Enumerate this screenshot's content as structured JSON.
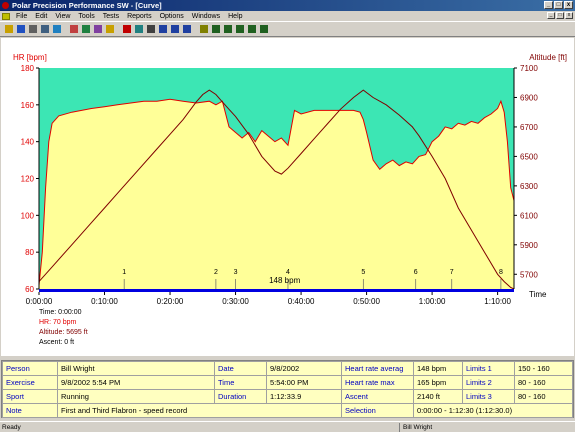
{
  "window": {
    "title": "Polar Precision Performance SW - [Curve]"
  },
  "menu": [
    "File",
    "Edit",
    "View",
    "Tools",
    "Tests",
    "Reports",
    "Options",
    "Windows",
    "Help"
  ],
  "toolbar": [
    "open-icon",
    "save-icon",
    "print-icon",
    "preview-icon",
    "globe-icon",
    "calendar-icon",
    "book-icon",
    "edit-icon",
    "open-folder-icon",
    "curve-icon",
    "chart-icon",
    "table-icon",
    "zoom-in-icon",
    "zoom-out-icon",
    "zoom-tool-icon",
    "picture-icon",
    "bar-chart-1-icon",
    "bar-chart-2-icon",
    "bar-chart-3-icon",
    "bar-chart-4-icon",
    "bar-chart-5-icon"
  ],
  "colors": {
    "above_hr": "#3ce6b4",
    "below_hr": "#ffff98",
    "hr_line": "#e00000",
    "altitude_line": "#800000",
    "lap_bar": "#0000e0",
    "title_bar": "#0a246a"
  },
  "chart_data": {
    "type": "line",
    "left_axis": {
      "label": "HR [bpm]",
      "ticks": [
        "180",
        "160",
        "140",
        "120",
        "100",
        "80",
        "60"
      ],
      "min": 60,
      "max": 180
    },
    "right_axis": {
      "label": "Altitude [ft]",
      "ticks": [
        "7100",
        "6900",
        "6700",
        "6500",
        "6300",
        "6100",
        "5900",
        "5700"
      ],
      "min": 5600,
      "max": 7100
    },
    "x_axis": {
      "label": "Time",
      "ticks": [
        "0:00:00",
        "0:10:00",
        "0:20:00",
        "0:30:00",
        "0:40:00",
        "0:50:00",
        "1:00:00",
        "1:10:00"
      ],
      "max_minutes": 72.5
    },
    "heart_rate": {
      "name": "HR",
      "x_minutes": [
        0,
        0.5,
        1,
        1.5,
        2,
        3,
        5,
        8,
        10,
        12,
        14,
        16,
        18,
        20,
        22,
        24,
        26,
        27,
        28,
        29,
        30,
        31,
        32,
        33,
        34,
        35,
        36,
        37,
        38,
        39,
        40,
        42,
        44,
        46,
        48,
        49,
        49.5,
        50,
        51,
        52,
        53,
        54,
        55,
        56,
        57,
        58,
        59,
        60,
        61,
        62,
        63,
        64,
        65,
        66,
        67,
        68,
        69,
        70,
        70.5,
        71,
        71.5,
        72,
        72.5
      ],
      "values": [
        62,
        80,
        115,
        140,
        150,
        154,
        156,
        158,
        159,
        160,
        161,
        162,
        162,
        163,
        162,
        161,
        162,
        160,
        162,
        148,
        145,
        142,
        145,
        140,
        146,
        143,
        140,
        142,
        138,
        157,
        155,
        157,
        157,
        157,
        157,
        156,
        152,
        145,
        130,
        125,
        128,
        130,
        127,
        129,
        128,
        132,
        133,
        140,
        143,
        148,
        147,
        150,
        149,
        151,
        150,
        153,
        155,
        158,
        162,
        156,
        140,
        115,
        108
      ]
    },
    "altitude": {
      "name": "Altitude",
      "x_minutes": [
        0,
        2,
        5,
        8,
        10,
        12,
        15,
        18,
        20,
        22,
        24,
        25,
        26,
        27,
        28,
        29,
        30,
        32,
        34,
        36,
        37,
        38,
        40,
        42,
        44,
        46,
        48,
        49.5,
        51,
        53,
        55,
        57,
        58,
        60,
        62,
        64,
        66,
        68,
        70,
        71,
        72,
        72.5
      ],
      "values": [
        5650,
        5750,
        5900,
        6050,
        6150,
        6250,
        6400,
        6550,
        6650,
        6750,
        6870,
        6920,
        6950,
        6920,
        6870,
        6820,
        6770,
        6650,
        6500,
        6400,
        6380,
        6420,
        6520,
        6620,
        6720,
        6820,
        6900,
        6950,
        6900,
        6850,
        6780,
        6700,
        6640,
        6500,
        6350,
        6150,
        6000,
        5850,
        5700,
        5650,
        5610,
        5600
      ]
    },
    "hr_limit": 148,
    "laps": [
      "1",
      "2",
      "3",
      "4",
      "5",
      "6",
      "7",
      "8"
    ],
    "lap_minutes": [
      13,
      27,
      30,
      38,
      49.5,
      57.5,
      63,
      70.5
    ],
    "hr_limit_label": "148 bpm"
  },
  "cursor_info": {
    "time": "Time: 0:00:00",
    "hr": "HR: 70 bpm",
    "altitude": "Altitude: 5695 ft",
    "ascent": "Ascent: 0 ft"
  },
  "details": {
    "person_label": "Person",
    "person": "Bill Wright",
    "exercise_label": "Exercise",
    "exercise": "9/8/2002 5:54 PM",
    "sport_label": "Sport",
    "sport": "Running",
    "note_label": "Note",
    "note": "First and Third Flabron - speed record",
    "date_label": "Date",
    "date": "9/8/2002",
    "time_label": "Time",
    "time": "5:54:00 PM",
    "duration_label": "Duration",
    "duration": "1:12:33.9",
    "hr_avg_label": "Heart rate averag",
    "hr_avg": "148 bpm",
    "hr_max_label": "Heart rate max",
    "hr_max": "165 bpm",
    "ascent_label": "Ascent",
    "ascent": "2140",
    "selection_label": "Selection",
    "selection": "0:00:00 - 1:12:30 (1:12:30.0)",
    "limits1_label": "Limits 1",
    "limits1": "150 - 160",
    "limits2_label": "Limits 2",
    "limits2": "80 - 160",
    "limits3_label": "Limits 3",
    "limits3": "80 - 160",
    "ft_label": "ft"
  },
  "status": {
    "left": "Ready",
    "user": "Bill Wright"
  }
}
